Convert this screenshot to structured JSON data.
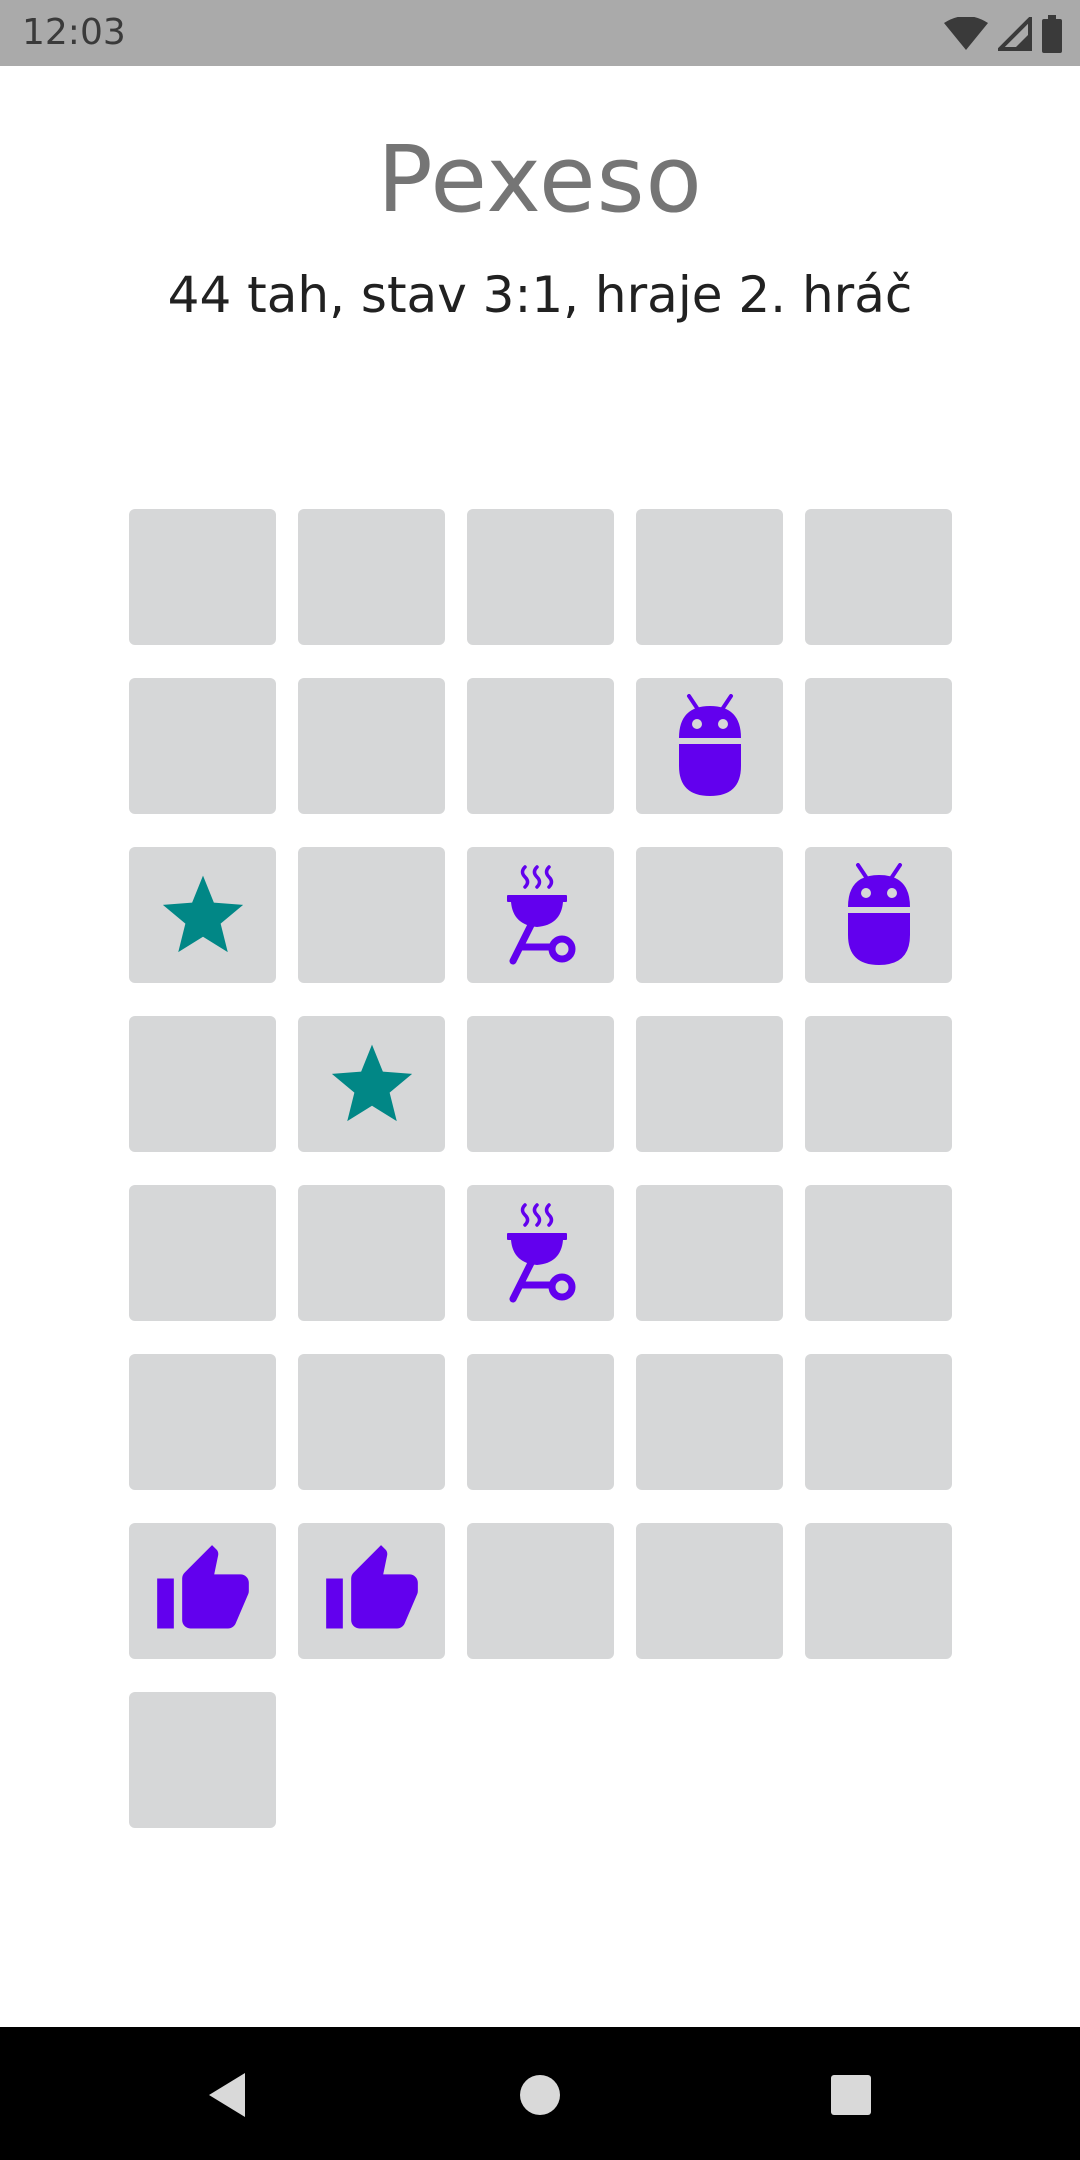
{
  "status_bar": {
    "time": "12:03",
    "icons": [
      "wifi-icon",
      "cell-signal-icon",
      "battery-icon"
    ]
  },
  "title": "Pexeso",
  "subtitle": "44 tah, stav 3:1, hraje 2. hráč",
  "board": {
    "columns": 5,
    "cards": [
      "hidden",
      "hidden",
      "hidden",
      "hidden",
      "hidden",
      "hidden",
      "hidden",
      "hidden",
      "android",
      "hidden",
      "star",
      "hidden",
      "grill",
      "hidden",
      "android",
      "hidden",
      "star",
      "hidden",
      "hidden",
      "hidden",
      "hidden",
      "hidden",
      "grill",
      "hidden",
      "hidden",
      "hidden",
      "hidden",
      "hidden",
      "hidden",
      "hidden",
      "thumb-up",
      "thumb-up",
      "hidden",
      "hidden",
      "hidden",
      "hidden"
    ]
  },
  "colors": {
    "card_back": "#d6d7d8",
    "purple": "#6200ee",
    "teal": "#018786",
    "status_bar": "#aaaaaa",
    "nav_bar": "#000000"
  },
  "nav_bar": {
    "buttons": [
      "back-icon",
      "home-icon",
      "recents-icon"
    ]
  }
}
